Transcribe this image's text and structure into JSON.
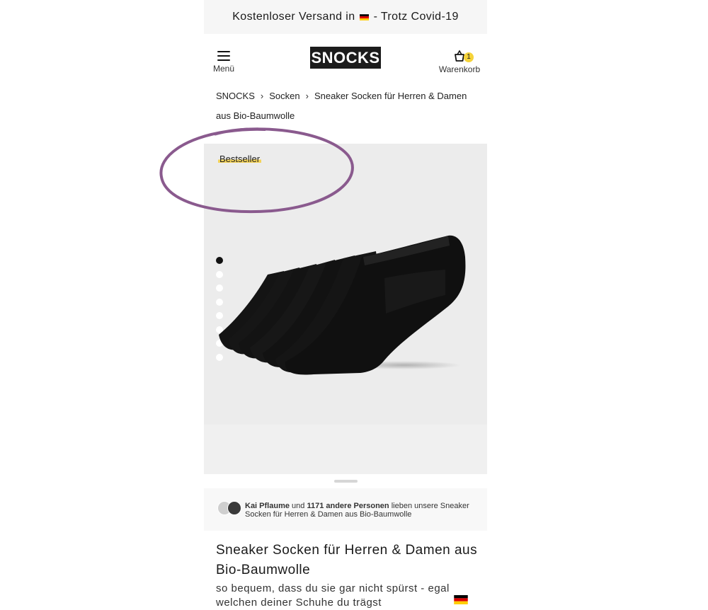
{
  "announcement": {
    "text_before_flag": "Kostenloser Versand in",
    "text_after_flag": "- Trotz Covid-19",
    "flag_icon": "germany-flag-icon"
  },
  "header": {
    "menu_label": "Menü",
    "logo": "SNOCKS",
    "cart_label": "Warenkorb",
    "cart_count": "1",
    "badge_color": "#f5d33a"
  },
  "breadcrumb": {
    "items": [
      "SNOCKS",
      "Socken",
      "Sneaker Socken für Herren & Damen aus Bio-Baumwolle"
    ],
    "separator": "›"
  },
  "gallery": {
    "badge": "Bestseller",
    "image_count": 8,
    "active_index": 0,
    "annotation_color": "#8a5a8e"
  },
  "social_proof": {
    "name": "Kai Pflaume",
    "connector": "und",
    "count_text": "1171 andere Personen",
    "suffix": "lieben unsere Sneaker Socken für Herren & Damen aus Bio-Baumwolle"
  },
  "product": {
    "title": "Sneaker Socken für Herren & Damen aus Bio-Baumwolle",
    "subtitle": "so bequem, dass du sie gar nicht spürst - egal welchen deiner Schuhe du trägst"
  }
}
